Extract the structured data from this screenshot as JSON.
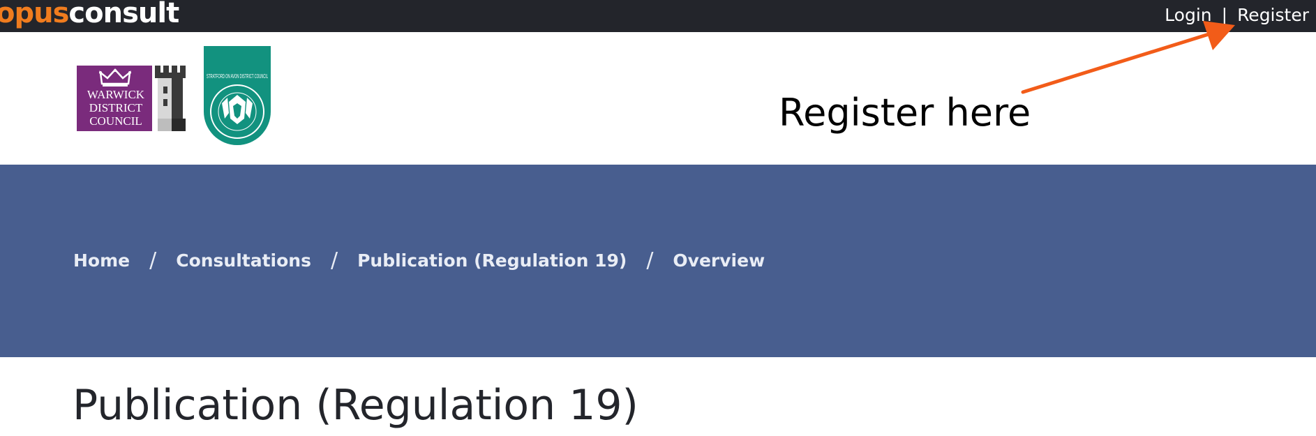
{
  "header": {
    "brand_prefix": "opus",
    "brand_suffix": "consult",
    "login_label": "Login",
    "separator": "|",
    "register_label": "Register"
  },
  "logos": {
    "warwick_line1": "WARWICK",
    "warwick_line2": "DISTRICT",
    "warwick_line3": "COUNCIL",
    "stratford_text": "STRATFORD ON AVON DISTRICT COUNCIL"
  },
  "annotation": {
    "text": "Register here",
    "color": "#f25c19"
  },
  "breadcrumb": {
    "items": [
      {
        "label": "Home"
      },
      {
        "label": "Consultations"
      },
      {
        "label": "Publication (Regulation 19)"
      },
      {
        "label": "Overview"
      }
    ],
    "separator": "/"
  },
  "page": {
    "title": "Publication (Regulation 19)"
  },
  "colors": {
    "topbar": "#23252b",
    "brand_accent": "#f07c1e",
    "banner": "#485e8f",
    "warwick_purple": "#7a2b7c",
    "stratford_teal": "#12927f"
  }
}
